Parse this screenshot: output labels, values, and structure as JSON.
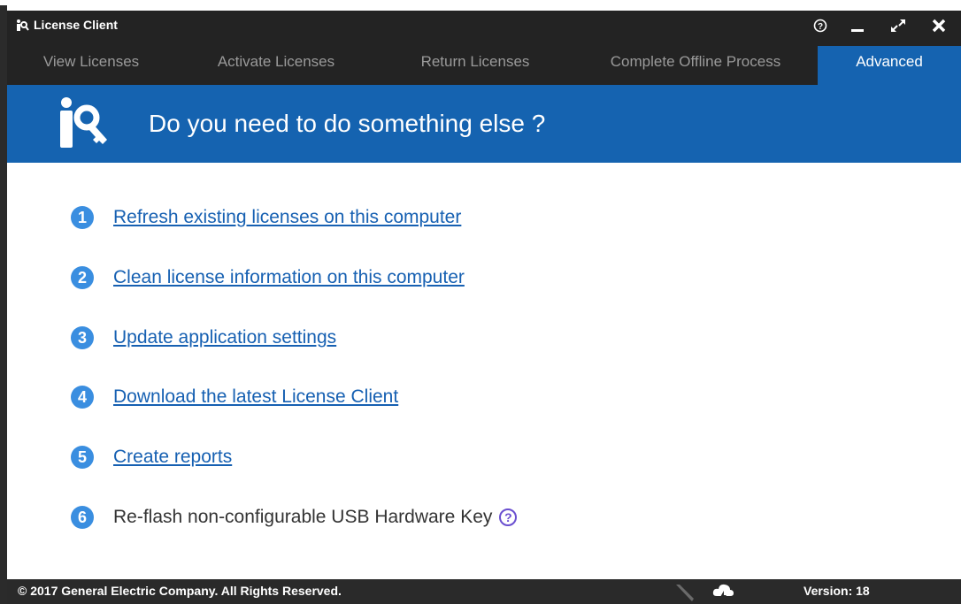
{
  "window": {
    "title": "License Client",
    "controls": {
      "help": "?",
      "minimize": "minimize",
      "restore": "restore",
      "close": "close"
    }
  },
  "tabs": [
    {
      "label": "View Licenses",
      "active": false
    },
    {
      "label": "Activate Licenses",
      "active": false
    },
    {
      "label": "Return Licenses",
      "active": false
    },
    {
      "label": "Complete Offline Process",
      "active": false
    },
    {
      "label": "Advanced",
      "active": true
    }
  ],
  "banner": {
    "heading": "Do you need to do something else ?"
  },
  "actions": [
    {
      "number": "1",
      "label": "Refresh existing licenses on this computer",
      "link": true
    },
    {
      "number": "2",
      "label": "Clean license information on this computer",
      "link": true
    },
    {
      "number": "3",
      "label": "Update application settings",
      "link": true
    },
    {
      "number": "4",
      "label": "Download the latest License Client",
      "link": true
    },
    {
      "number": "5",
      "label": "Create reports",
      "link": true
    },
    {
      "number": "6",
      "label": "Re-flash non-configurable USB Hardware Key",
      "link": false,
      "help": "?"
    }
  ],
  "footer": {
    "copyright": "© 2017 General Electric Company.  All Rights Reserved.",
    "version_label": "Version:",
    "version_value": "18"
  },
  "colors": {
    "titlebar": "#232323",
    "accent": "#1563b0",
    "link": "#1660b2",
    "badge": "#3a8ee0",
    "footer": "#2a2a2a"
  }
}
